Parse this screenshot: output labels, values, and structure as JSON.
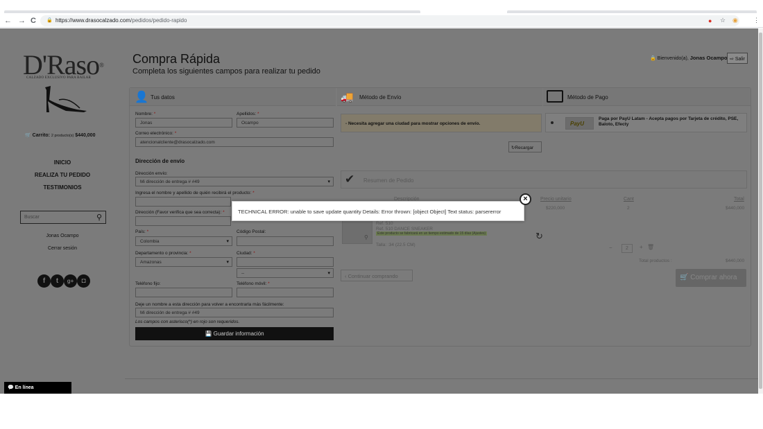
{
  "browser": {
    "url_host": "https://www.drasocalzado.com",
    "url_path": "/pedidos/pedido-rapido",
    "back": "←",
    "forward": "→",
    "reload": "C",
    "star": "☆",
    "menu": "⋮"
  },
  "sidebar": {
    "logo": "D'Raso",
    "logo_mark": "®",
    "logo_tagline": "CALZADO EXCLUSIVO PARA BAILAR",
    "cart_label": "Carrito:",
    "cart_count": "2 producto(s)",
    "cart_total": "$440,000",
    "menu": [
      "INICIO",
      "REALIZA TU PEDIDO",
      "TESTIMONIOS"
    ],
    "search_placeholder": "Buscar",
    "user_name": "Jonas Ocampo",
    "logout": "Cerrar sesión",
    "social_icons": [
      "facebook-icon",
      "twitter-icon",
      "google-plus-icon",
      "instagram-icon"
    ],
    "chat_label": "En línea"
  },
  "header": {
    "title": "Compra Rápida",
    "subtitle": "Completa los siguientes campos para realizar tu pedido",
    "welcome": "Bienvenido(a),",
    "user": "Jonas Ocampo",
    "logout_button": "Salir"
  },
  "datos": {
    "title": "Tus datos",
    "nombre_label": "Nombre:",
    "nombre_value": "Jonas",
    "apellidos_label": "Apellidos:",
    "apellidos_value": "Ocampo",
    "correo_label": "Correo electrónico:",
    "correo_value": "atencionalcliente@drasocalzado.com",
    "direccion_section": "Dirección de envío",
    "dir_envio_label": "Dirección envío:",
    "dir_envio_value": "Mi dirección de entrega # #49",
    "receptor_label": "Ingresa el nombre y apellido de quién recibirá el producto:",
    "direccion_label": "Dirección (Favor verifica que sea correcta):",
    "pais_label": "País:",
    "pais_value": "Colombia",
    "postal_label": "Código Postal:",
    "depto_label": "Departamento o provincia:",
    "depto_value": "Amazonas",
    "ciudad_label": "Ciudad:",
    "ciudad_select_value": "--",
    "telfijo_label": "Teléfono fijo:",
    "telmovil_label": "Teléfono móvil:",
    "alias_label": "Deje un nombre a esta dirección para volver a encontrarla más fácilmente:",
    "alias_value": "Mi dirección de entrega # #49",
    "hint": "Los campos con asterisco(*) en rojo son requeridos.",
    "save_button": "Guardar información",
    "required_mark": "*"
  },
  "envio": {
    "title": "Método de Envío",
    "message": "- Necesita agregar una ciudad para mostrar opciones de envío.",
    "reload_button": "Recargar"
  },
  "pago": {
    "title": "Método de Pago",
    "payu_logo": "PayU",
    "payu_text": "Paga por PayU Latam - Acepta pagos por Tarjeta de crédito, PSE, Baloto, Efecty"
  },
  "resumen": {
    "title": "Resumen de Pedido",
    "col_descripcion": "Descripción",
    "col_precio": "Precio unitario",
    "col_cant": "Cant",
    "col_total": "Total",
    "precio": "$220,000",
    "cantidad": "2",
    "total": "$440,000",
    "product_code": "Ref. 510",
    "product_name": "Ref. 510 DANCE SNEAKER",
    "product_note": "Este producto se fabricará en un tiempo estimado de 15 días (Ajustes)",
    "talla": "Talla: :34 (22.5 CM)",
    "qty_value": "2",
    "total_productos_label": "Total productos :",
    "total_productos_value": "$440,000",
    "buy_button": "Comprar ahora",
    "continue_button": "Continuar comprando"
  },
  "modal": {
    "message": "TECHNICAL ERROR: unable to save update quantity Details: Error thrown: [object Object] Text status: parsererror",
    "close": "×"
  }
}
